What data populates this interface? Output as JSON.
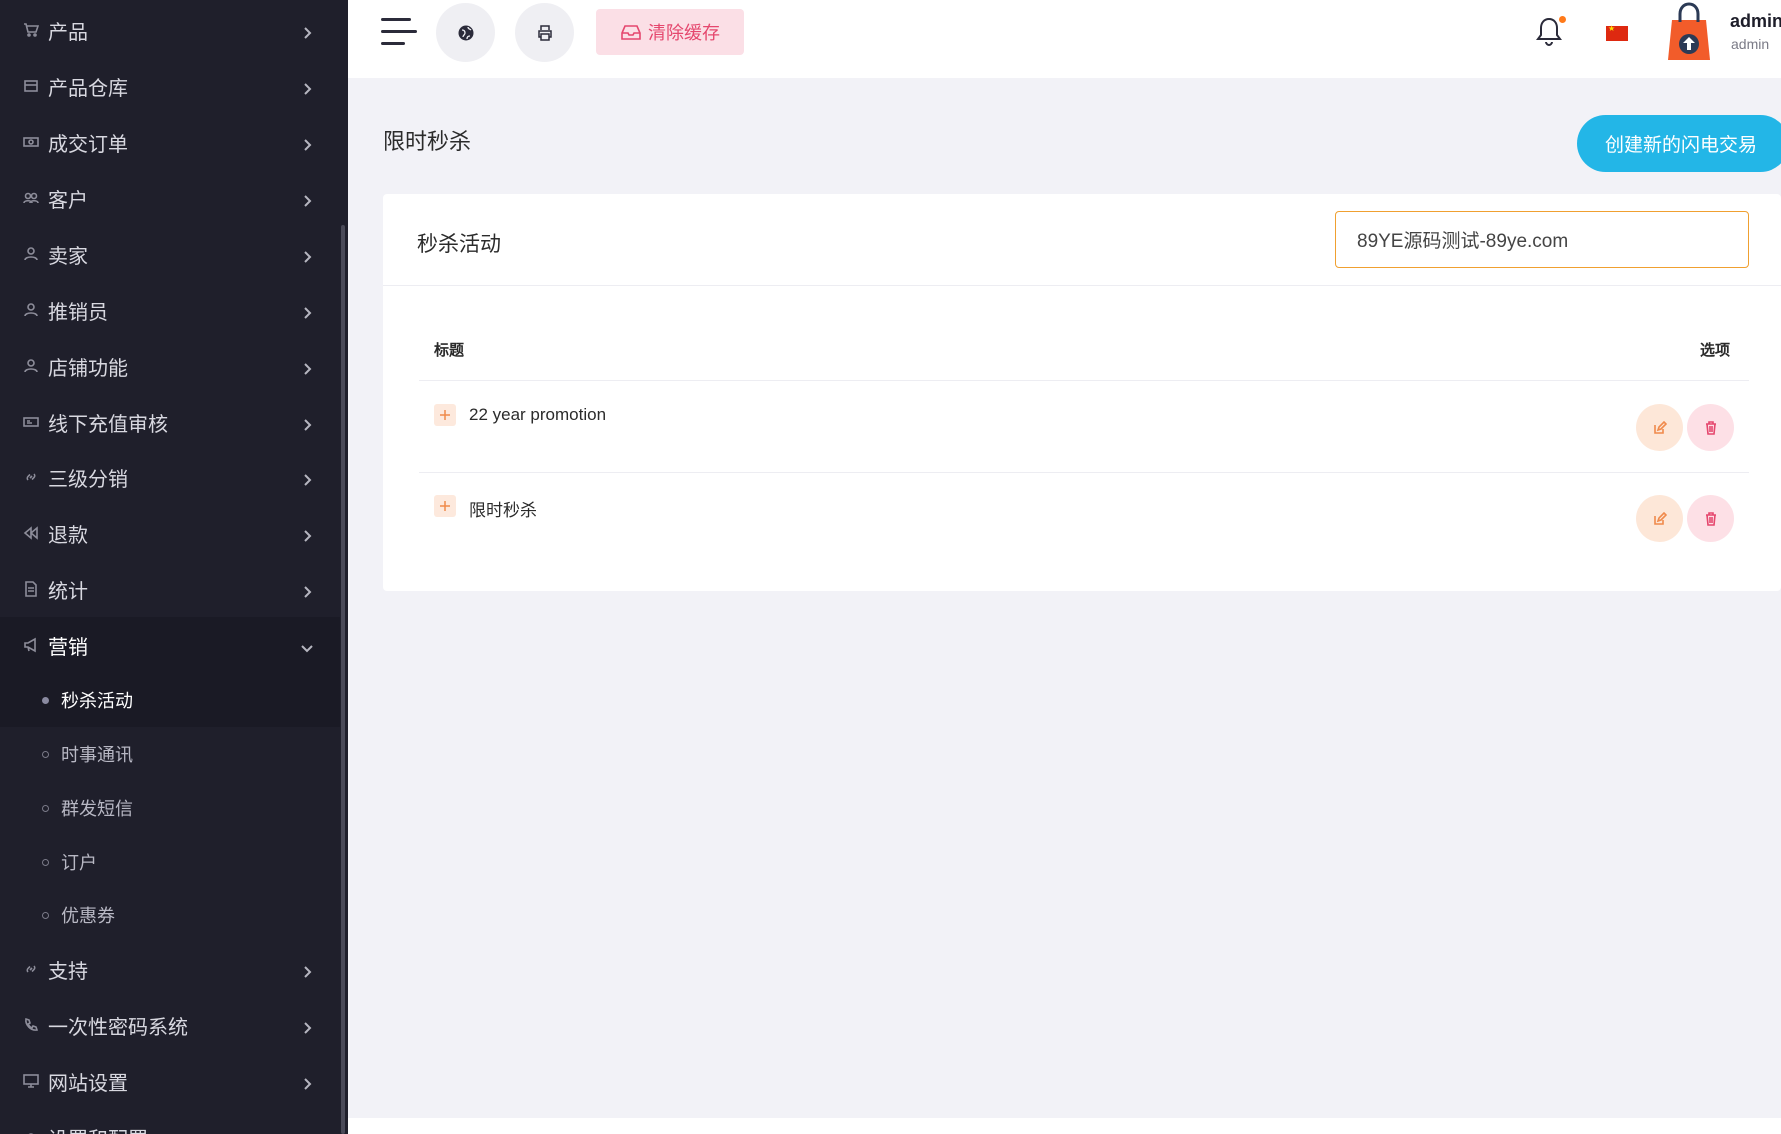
{
  "sidebar": {
    "items": [
      {
        "label": "产品",
        "icon": "cart-icon"
      },
      {
        "label": "产品仓库",
        "icon": "warehouse-icon"
      },
      {
        "label": "成交订单",
        "icon": "money-icon"
      },
      {
        "label": "客户",
        "icon": "users-icon"
      },
      {
        "label": "卖家",
        "icon": "user-icon"
      },
      {
        "label": "推销员",
        "icon": "user-icon"
      },
      {
        "label": "店铺功能",
        "icon": "user-icon"
      },
      {
        "label": "线下充值审核",
        "icon": "card-icon"
      },
      {
        "label": "三级分销",
        "icon": "link-icon"
      },
      {
        "label": "退款",
        "icon": "rewind-icon"
      },
      {
        "label": "统计",
        "icon": "document-icon"
      },
      {
        "label": "营销",
        "icon": "megaphone-icon"
      },
      {
        "label": "支持",
        "icon": "link-icon"
      },
      {
        "label": "一次性密码系统",
        "icon": "phone-icon"
      },
      {
        "label": "网站设置",
        "icon": "monitor-icon"
      },
      {
        "label": "设置和配置",
        "icon": "settings-icon"
      }
    ],
    "submenu": [
      {
        "label": "秒杀活动"
      },
      {
        "label": "时事通讯"
      },
      {
        "label": "群发短信"
      },
      {
        "label": "订户"
      },
      {
        "label": "优惠券"
      }
    ]
  },
  "topbar": {
    "clear_cache_label": "清除缓存",
    "user_name": "admin",
    "user_role": "admin",
    "notification_accent": "#ff7a1a"
  },
  "main": {
    "page_title": "限时秒杀",
    "create_button_label": "创建新的闪电交易",
    "card_title": "秒杀活动",
    "search_value": "89YE源码测试-89ye.com",
    "columns": {
      "title": "标题",
      "options": "选项"
    },
    "rows": [
      {
        "title": "22 year promotion"
      },
      {
        "title": "限时秒杀"
      }
    ]
  },
  "colors": {
    "sidebar_bg": "#1f1f2b",
    "accent_blue": "#23b6e7",
    "danger_pink": "#e5476e",
    "warning_orange": "#f08a4b"
  }
}
